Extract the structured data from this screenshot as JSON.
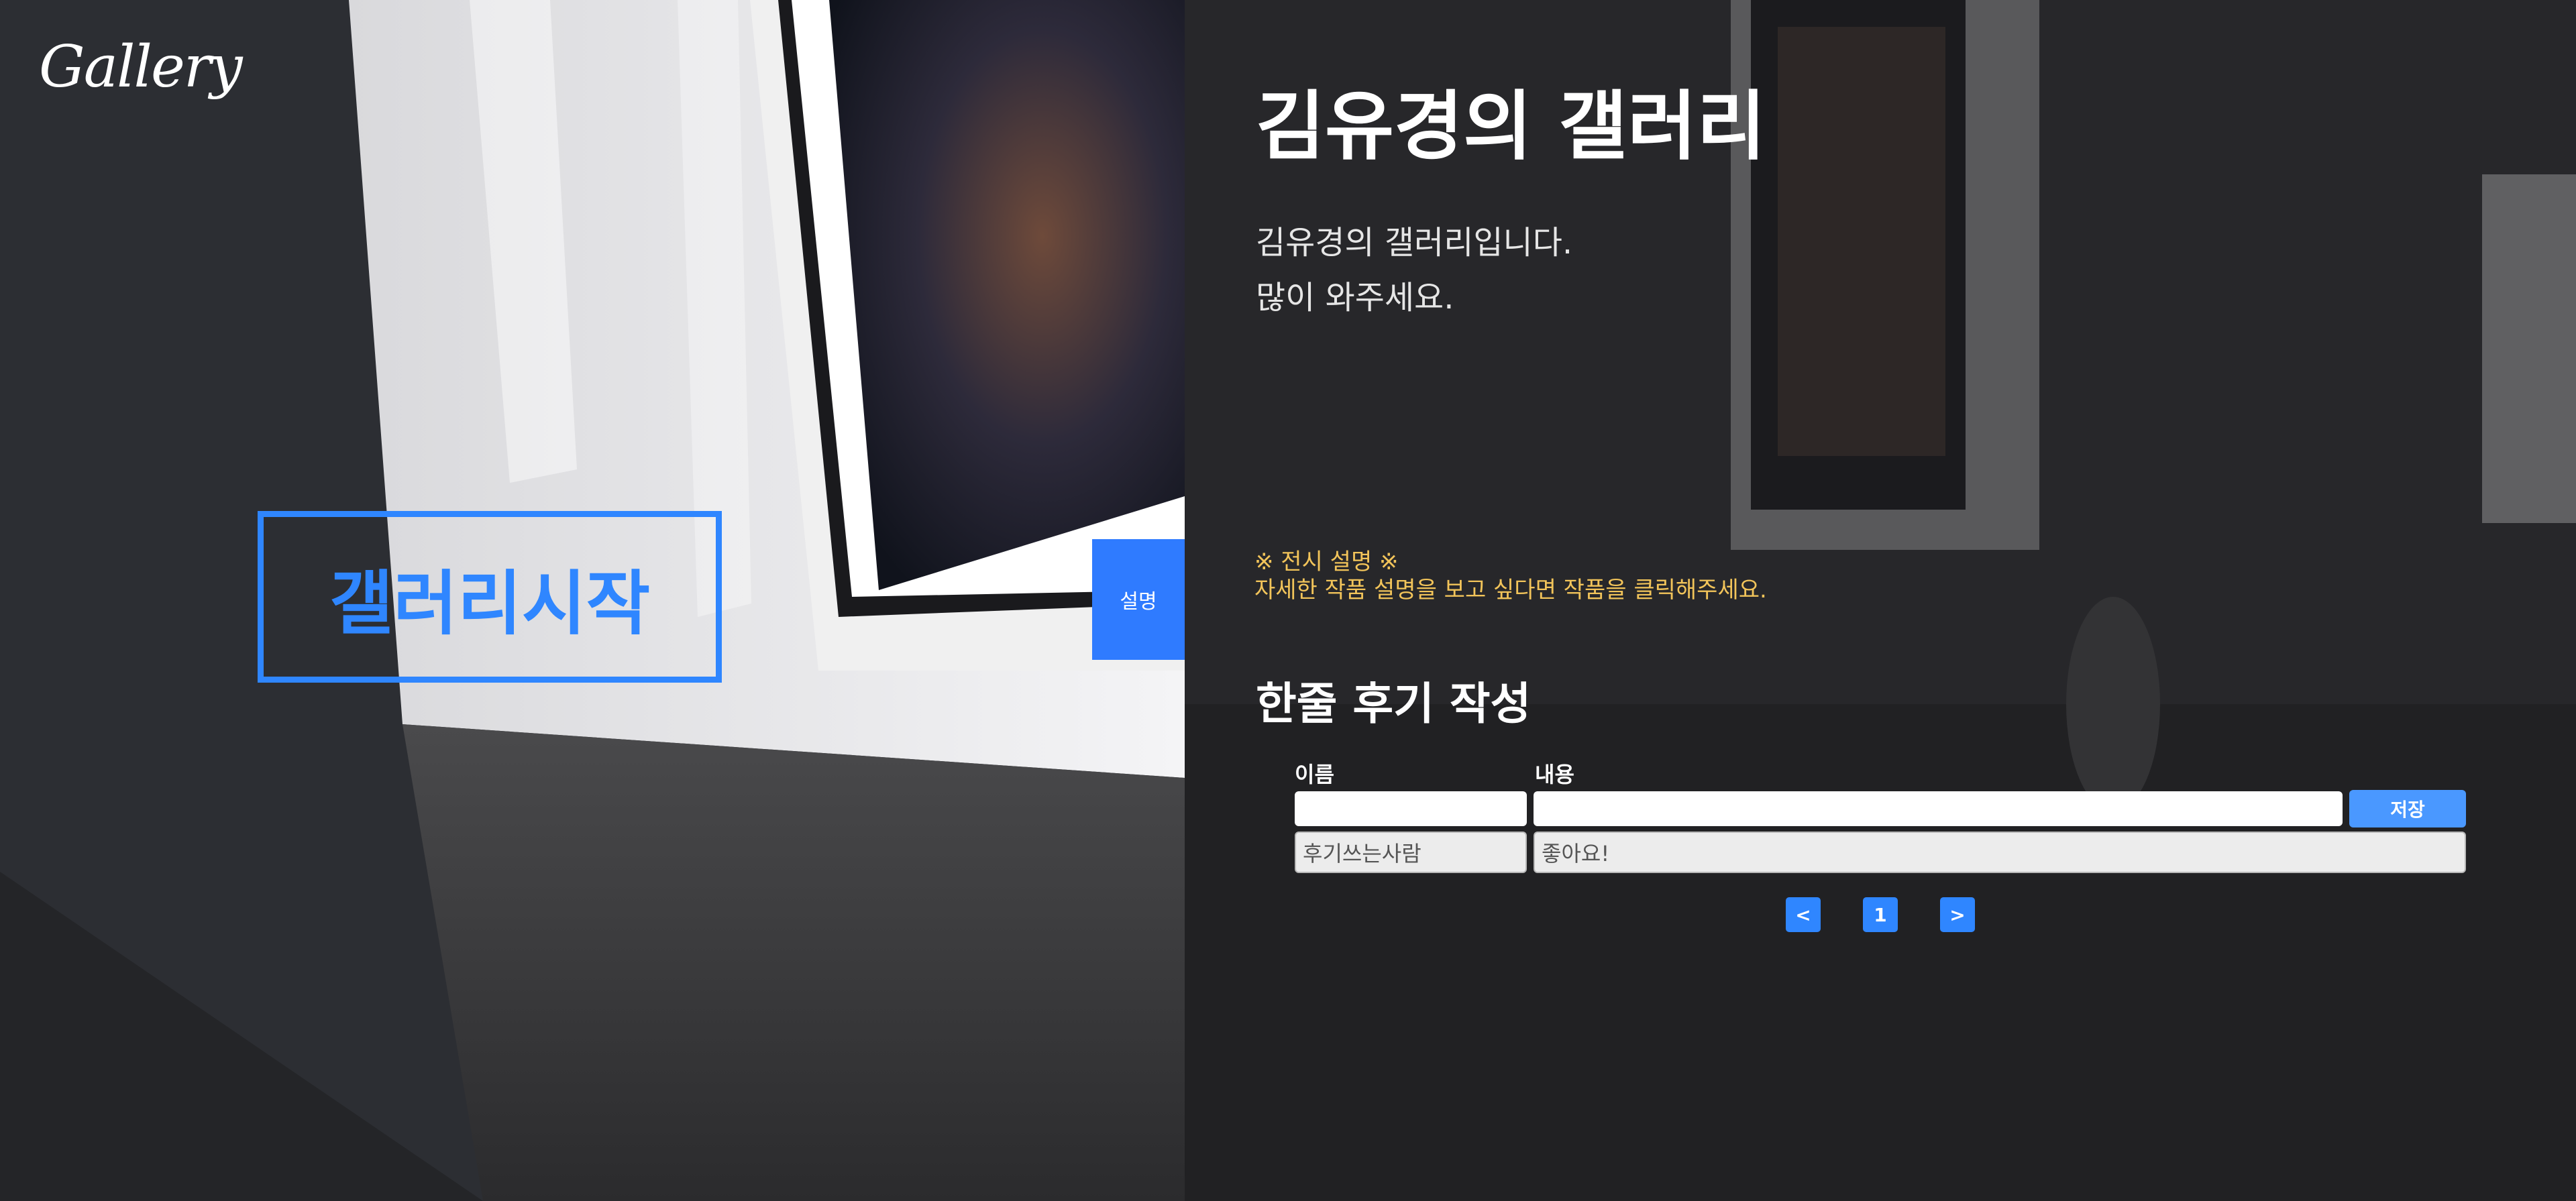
{
  "brand": {
    "logo_text": "Gallery"
  },
  "start_button": {
    "label": "갤러리시작"
  },
  "description_tab": {
    "label": "설명"
  },
  "gallery": {
    "title": "김유경의 갤러리",
    "intro_line1": "김유경의 갤러리입니다.",
    "intro_line2": "많이 와주세요."
  },
  "notice": {
    "title": "※ 전시 설명 ※",
    "text": "자세한 작품 설명을 보고 싶다면 작품을 클릭해주세요."
  },
  "review": {
    "heading": "한줄 후기 작성",
    "name_label": "이름",
    "content_label": "내용",
    "name_value": "",
    "content_value": "",
    "save_label": "저장",
    "entries": [
      {
        "name": "후기쓰는사람",
        "content": "좋아요!"
      }
    ]
  },
  "pagination": {
    "prev": "<",
    "current": "1",
    "next": ">"
  },
  "colors": {
    "accent": "#2f86ff",
    "notice": "#f2c45a",
    "panel_overlay": "#1c1c1e"
  }
}
